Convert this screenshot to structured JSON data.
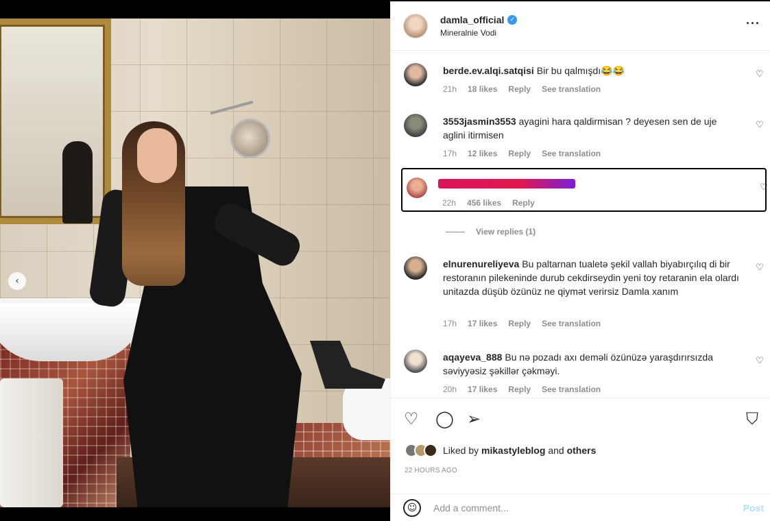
{
  "post": {
    "owner": "damla_official",
    "location": "Mineralnie Vodi",
    "verified": true
  },
  "comments": [
    {
      "username": "berde.ev.alqi.satqisi",
      "text": "Bir bu qalmışdı😂😂",
      "time": "21h",
      "likes": "18 likes",
      "reply": "Reply",
      "translate": "See translation"
    },
    {
      "username": "3553jasmin3553",
      "text": "ayagini hara qaldirmisan ?  deyesen sen de uje aglini itirmisen",
      "time": "17h",
      "likes": "12 likes",
      "reply": "Reply",
      "translate": "See translation"
    },
    {
      "username": "",
      "text": "",
      "time": "22h",
      "likes": "456 likes",
      "reply": "Reply",
      "redacted": true
    },
    {
      "username": "elnurenureliyeva",
      "text": "Bu paltarnan tualetə şekil vallah biyabırçılıq di bir restoranın pilekeninde durub cekdirseydin yeni toy retaranin ela olardı unitazda düşüb özünüz ne qiymət verirsiz Damla xanım",
      "time": "17h",
      "likes": "17 likes",
      "reply": "Reply",
      "translate": "See translation"
    },
    {
      "username": "aqayeva_888",
      "text": "Bu nə pozadı axı deməli özünüzə yaraşdırırsızda səviyyəsiz şəkillər çəkməyi.",
      "time": "20h",
      "likes": "17 likes",
      "reply": "Reply",
      "translate": "See translation"
    }
  ],
  "view_replies": "View replies (1)",
  "liked_by": {
    "prefix": "Liked by",
    "user": "mikastyleblog",
    "and": "and",
    "others": "others"
  },
  "time_ago": "22 HOURS AGO",
  "add_comment": {
    "placeholder": "Add a comment...",
    "post_label": "Post"
  },
  "icons": {
    "heart": "heart-icon",
    "comment": "comment-icon",
    "share": "share-icon",
    "save": "bookmark-icon",
    "emoji": "emoji-icon",
    "more": "more-options-icon"
  },
  "colors": {
    "verified": "#3897f0",
    "post_disabled": "#b2dffc",
    "muted": "#8e8e8e",
    "redaction": "#d9145a"
  }
}
